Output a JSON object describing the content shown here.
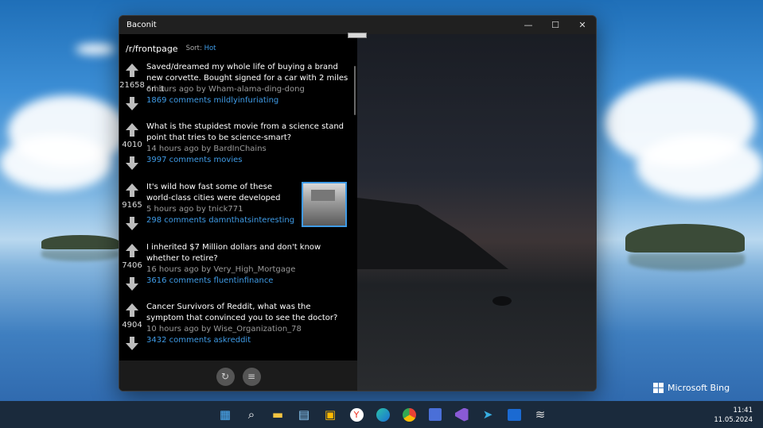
{
  "window": {
    "title": "Baconit",
    "controls": {
      "minimize": "—",
      "maximize": "☐",
      "close": "✕"
    }
  },
  "header": {
    "subreddit": "/r/frontpage",
    "sort_label": "Sort:",
    "sort_value": "Hot"
  },
  "posts": [
    {
      "score": "21658",
      "title": "Saved/dreamed my whole life of buying a brand new corvette. Bought signed for a car with 2 miles on it",
      "meta": "6 hours ago by Wham-alama-ding-dong",
      "comments": "1869 comments",
      "subreddit": "mildlyinfuriating",
      "has_thumbnail": false
    },
    {
      "score": "4010",
      "title": "What is the stupidest movie from a science stand point that tries to be science-smart?",
      "meta": "14 hours ago by BardInChains",
      "comments": "3997 comments",
      "subreddit": "movies",
      "has_thumbnail": false
    },
    {
      "score": "9165",
      "title": "It's wild how fast some of these world-class cities were developed",
      "meta": "5 hours ago by tnick771",
      "comments": "298 comments",
      "subreddit": "damnthatsinteresting",
      "has_thumbnail": true
    },
    {
      "score": "7406",
      "title": "I inherited $7 Million dollars and don't know whether to retire?",
      "meta": "16 hours ago by Very_High_Mortgage",
      "comments": "3616 comments",
      "subreddit": "fluentinfinance",
      "has_thumbnail": false
    },
    {
      "score": "4904",
      "title": "Cancer Survivors of Reddit, what was the symptom that convinced you to see the doctor?",
      "meta": "10 hours ago by Wise_Organization_78",
      "comments": "3432 comments",
      "subreddit": "askreddit",
      "has_thumbnail": false
    }
  ],
  "bottombar": {
    "refresh_glyph": "↻",
    "menu_glyph": "≡"
  },
  "taskbar": {
    "icons": [
      "windows-start-icon",
      "search-icon",
      "file-explorer-icon",
      "notepad-icon",
      "store-icon",
      "yandex-icon",
      "edge-icon",
      "chrome-icon",
      "save-icon",
      "visual-studio-icon",
      "telegram-icon",
      "outlook-icon",
      "baconit-icon"
    ],
    "time": "11:41",
    "date": "11.05.2024"
  },
  "watermark": "Microsoft Bing",
  "colors": {
    "accent": "#3f9be6",
    "panel": "#000000",
    "titlebar": "#202020"
  }
}
